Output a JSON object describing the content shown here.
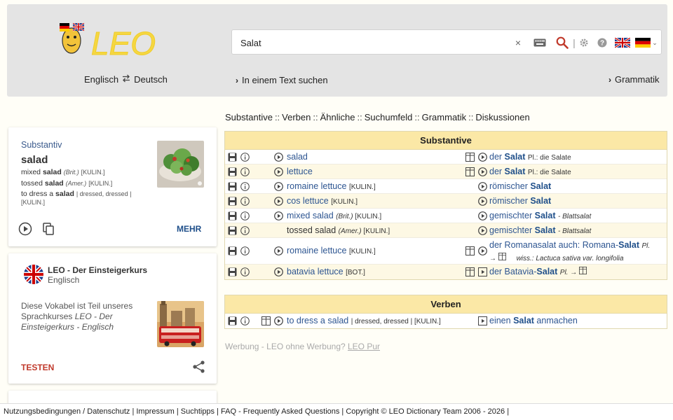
{
  "header": {
    "logo_text": "LEO",
    "search_value": "Salat",
    "lang_left": "Englisch",
    "lang_swap_icon": "swap-arrows-icon",
    "lang_right": "Deutsch",
    "text_search_label": "In einem Text suchen",
    "grammar_label": "Grammatik"
  },
  "tabs": [
    "Substantive",
    "Verben",
    "Ähnliche",
    "Suchumfeld",
    "Grammatik",
    "Diskussionen"
  ],
  "tab_separator": "::",
  "sidebar_card": {
    "category": "Substantiv",
    "word": "salad",
    "lines": [
      {
        "pre": "mixed ",
        "bold": "salad",
        "note": "(Brit.)",
        "tag": "[KULIN.]"
      },
      {
        "pre": "tossed ",
        "bold": "salad",
        "note": "(Amer.)",
        "tag": "[KULIN.]"
      },
      {
        "pre": "to dress a ",
        "bold": "salad",
        "note": "",
        "tag": "| dressed, dressed |"
      }
    ],
    "line3_tag2": "[KULIN.]",
    "more_label": "MEHR"
  },
  "course_card": {
    "title": "LEO - Der Einsteigerkurs",
    "subtitle": "Englisch",
    "text_plain": "Diese Vokabel ist Teil unseres Sprachkurses ",
    "text_italic": "LEO - Der Einsteigerkurs - Englisch",
    "action_label": "TESTEN"
  },
  "nouns_table": {
    "heading": "Substantive",
    "rows": [
      {
        "en": "salad",
        "en_note": "",
        "en_tag": "",
        "de_bold": "Salat",
        "de_pre": "der ",
        "de_post": "",
        "de_gram": "Pl.: die Salate",
        "de_line2": ""
      },
      {
        "en": "lettuce",
        "en_note": "",
        "en_tag": "",
        "de_bold": "Salat",
        "de_pre": "der ",
        "de_post": "",
        "de_gram": "Pl.: die Salate",
        "de_line2": ""
      },
      {
        "en": "romaine lettuce",
        "en_note": "",
        "en_tag": "[KULIN.]",
        "de_bold": "Salat",
        "de_pre": "römischer ",
        "de_post": "",
        "de_gram": "",
        "de_line2": ""
      },
      {
        "en": "cos lettuce",
        "en_note": "",
        "en_tag": "[KULIN.]",
        "de_bold": "Salat",
        "de_pre": "römischer ",
        "de_post": "",
        "de_gram": "",
        "de_line2": ""
      },
      {
        "en": "mixed salad",
        "en_note": "(Brit.)",
        "en_tag": "[KULIN.]",
        "de_bold": "Salat",
        "de_pre": "gemischter ",
        "de_post": "",
        "de_gram": "- Blattsalat",
        "de_line2": ""
      },
      {
        "en": "tossed salad",
        "en_note": "(Amer.)",
        "en_tag": "[KULIN.]",
        "de_bold": "Salat",
        "de_pre": "gemischter ",
        "de_post": "",
        "de_gram": "- Blattsalat",
        "de_line2": ""
      },
      {
        "en": "romaine lettuce",
        "en_note": "",
        "en_tag": "[KULIN.]",
        "de_bold": "Salat",
        "de_pre": "der Romanasalat  auch: Romana-",
        "de_post": "",
        "de_gram": "Pl.",
        "de_line2": "wiss.: Lactuca sativa var. longifolia"
      },
      {
        "en": "batavia lettuce",
        "en_note": "",
        "en_tag": "[BOT.]",
        "de_bold": "Salat",
        "de_pre": "der Batavia-",
        "de_post": "",
        "de_gram": "Pl.",
        "de_line2": ""
      }
    ]
  },
  "verbs_table": {
    "heading": "Verben",
    "rows": [
      {
        "en": "to dress a salad",
        "en_tag": "| dressed, dressed | [KULIN.]",
        "de_pre": "einen ",
        "de_bold": "Salat",
        "de_post": " anmachen"
      }
    ]
  },
  "ad": {
    "text": "Werbung - LEO ohne Werbung? ",
    "link": "LEO Pur"
  },
  "footer": "Nutzungsbedingungen / Datenschutz | Impressum | Suchtipps | FAQ - Frequently Asked Questions | Copyright © LEO Dictionary Team 2006 - 2026 |",
  "colors": {
    "accent_blue": "#1f4f8a",
    "header_yellow": "#fbe8a6",
    "test_red": "#c0392b"
  }
}
